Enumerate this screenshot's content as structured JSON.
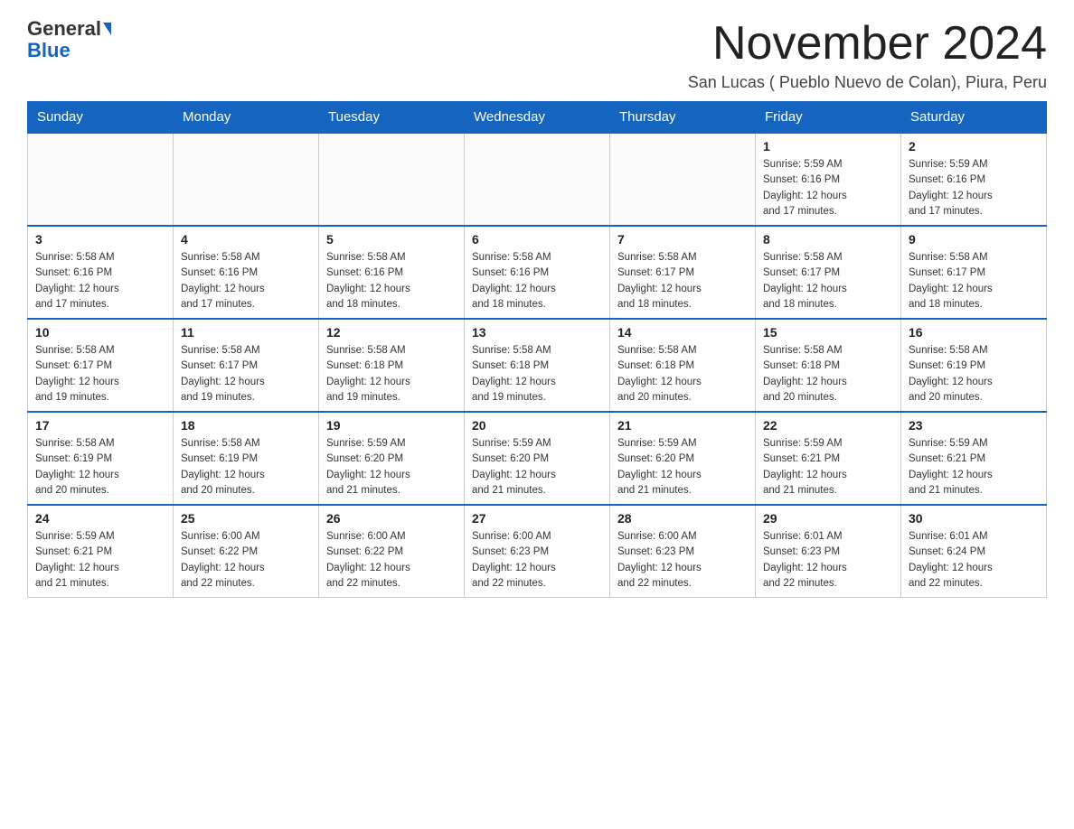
{
  "logo": {
    "text_general": "General",
    "text_blue": "Blue"
  },
  "header": {
    "month_title": "November 2024",
    "subtitle": "San Lucas ( Pueblo Nuevo de Colan), Piura, Peru"
  },
  "days_of_week": [
    "Sunday",
    "Monday",
    "Tuesday",
    "Wednesday",
    "Thursday",
    "Friday",
    "Saturday"
  ],
  "weeks": [
    [
      {
        "day": "",
        "info": ""
      },
      {
        "day": "",
        "info": ""
      },
      {
        "day": "",
        "info": ""
      },
      {
        "day": "",
        "info": ""
      },
      {
        "day": "",
        "info": ""
      },
      {
        "day": "1",
        "info": "Sunrise: 5:59 AM\nSunset: 6:16 PM\nDaylight: 12 hours\nand 17 minutes."
      },
      {
        "day": "2",
        "info": "Sunrise: 5:59 AM\nSunset: 6:16 PM\nDaylight: 12 hours\nand 17 minutes."
      }
    ],
    [
      {
        "day": "3",
        "info": "Sunrise: 5:58 AM\nSunset: 6:16 PM\nDaylight: 12 hours\nand 17 minutes."
      },
      {
        "day": "4",
        "info": "Sunrise: 5:58 AM\nSunset: 6:16 PM\nDaylight: 12 hours\nand 17 minutes."
      },
      {
        "day": "5",
        "info": "Sunrise: 5:58 AM\nSunset: 6:16 PM\nDaylight: 12 hours\nand 18 minutes."
      },
      {
        "day": "6",
        "info": "Sunrise: 5:58 AM\nSunset: 6:16 PM\nDaylight: 12 hours\nand 18 minutes."
      },
      {
        "day": "7",
        "info": "Sunrise: 5:58 AM\nSunset: 6:17 PM\nDaylight: 12 hours\nand 18 minutes."
      },
      {
        "day": "8",
        "info": "Sunrise: 5:58 AM\nSunset: 6:17 PM\nDaylight: 12 hours\nand 18 minutes."
      },
      {
        "day": "9",
        "info": "Sunrise: 5:58 AM\nSunset: 6:17 PM\nDaylight: 12 hours\nand 18 minutes."
      }
    ],
    [
      {
        "day": "10",
        "info": "Sunrise: 5:58 AM\nSunset: 6:17 PM\nDaylight: 12 hours\nand 19 minutes."
      },
      {
        "day": "11",
        "info": "Sunrise: 5:58 AM\nSunset: 6:17 PM\nDaylight: 12 hours\nand 19 minutes."
      },
      {
        "day": "12",
        "info": "Sunrise: 5:58 AM\nSunset: 6:18 PM\nDaylight: 12 hours\nand 19 minutes."
      },
      {
        "day": "13",
        "info": "Sunrise: 5:58 AM\nSunset: 6:18 PM\nDaylight: 12 hours\nand 19 minutes."
      },
      {
        "day": "14",
        "info": "Sunrise: 5:58 AM\nSunset: 6:18 PM\nDaylight: 12 hours\nand 20 minutes."
      },
      {
        "day": "15",
        "info": "Sunrise: 5:58 AM\nSunset: 6:18 PM\nDaylight: 12 hours\nand 20 minutes."
      },
      {
        "day": "16",
        "info": "Sunrise: 5:58 AM\nSunset: 6:19 PM\nDaylight: 12 hours\nand 20 minutes."
      }
    ],
    [
      {
        "day": "17",
        "info": "Sunrise: 5:58 AM\nSunset: 6:19 PM\nDaylight: 12 hours\nand 20 minutes."
      },
      {
        "day": "18",
        "info": "Sunrise: 5:58 AM\nSunset: 6:19 PM\nDaylight: 12 hours\nand 20 minutes."
      },
      {
        "day": "19",
        "info": "Sunrise: 5:59 AM\nSunset: 6:20 PM\nDaylight: 12 hours\nand 21 minutes."
      },
      {
        "day": "20",
        "info": "Sunrise: 5:59 AM\nSunset: 6:20 PM\nDaylight: 12 hours\nand 21 minutes."
      },
      {
        "day": "21",
        "info": "Sunrise: 5:59 AM\nSunset: 6:20 PM\nDaylight: 12 hours\nand 21 minutes."
      },
      {
        "day": "22",
        "info": "Sunrise: 5:59 AM\nSunset: 6:21 PM\nDaylight: 12 hours\nand 21 minutes."
      },
      {
        "day": "23",
        "info": "Sunrise: 5:59 AM\nSunset: 6:21 PM\nDaylight: 12 hours\nand 21 minutes."
      }
    ],
    [
      {
        "day": "24",
        "info": "Sunrise: 5:59 AM\nSunset: 6:21 PM\nDaylight: 12 hours\nand 21 minutes."
      },
      {
        "day": "25",
        "info": "Sunrise: 6:00 AM\nSunset: 6:22 PM\nDaylight: 12 hours\nand 22 minutes."
      },
      {
        "day": "26",
        "info": "Sunrise: 6:00 AM\nSunset: 6:22 PM\nDaylight: 12 hours\nand 22 minutes."
      },
      {
        "day": "27",
        "info": "Sunrise: 6:00 AM\nSunset: 6:23 PM\nDaylight: 12 hours\nand 22 minutes."
      },
      {
        "day": "28",
        "info": "Sunrise: 6:00 AM\nSunset: 6:23 PM\nDaylight: 12 hours\nand 22 minutes."
      },
      {
        "day": "29",
        "info": "Sunrise: 6:01 AM\nSunset: 6:23 PM\nDaylight: 12 hours\nand 22 minutes."
      },
      {
        "day": "30",
        "info": "Sunrise: 6:01 AM\nSunset: 6:24 PM\nDaylight: 12 hours\nand 22 minutes."
      }
    ]
  ]
}
